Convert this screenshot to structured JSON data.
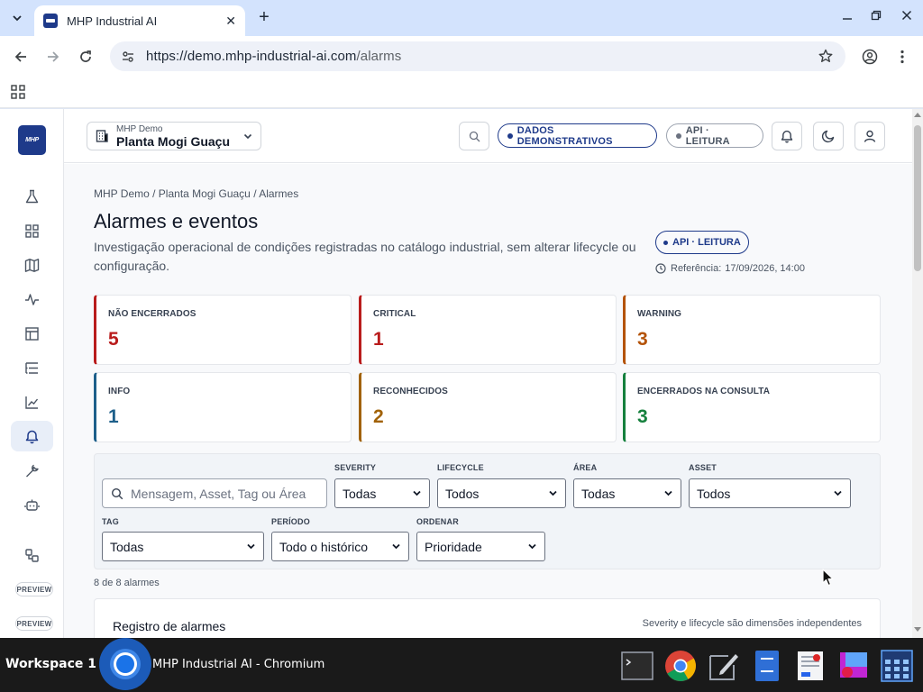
{
  "browser": {
    "tab_title": "MHP Industrial AI",
    "url_host": "https://demo.mhp-industrial-ai.com",
    "url_path": "/alarms",
    "close_glyph": "✕",
    "newtab_glyph": "+"
  },
  "topbar": {
    "org": "MHP Demo",
    "plant": "Planta Mogi Guaçu",
    "demo_pill": "DADOS DEMONSTRATIVOS",
    "api_pill": "API · LEITURA"
  },
  "sidebar": {
    "logo_text": "MHP",
    "items": [
      {
        "icon": "flask-icon"
      },
      {
        "icon": "grid-icon"
      },
      {
        "icon": "map-icon"
      },
      {
        "icon": "activity-icon"
      },
      {
        "icon": "layout-icon"
      },
      {
        "icon": "list-tree-icon"
      },
      {
        "icon": "chart-line-icon"
      },
      {
        "icon": "bell-icon",
        "active": true
      },
      {
        "icon": "wrench-icon"
      },
      {
        "icon": "bot-icon"
      },
      {
        "icon": "workflow-icon"
      }
    ],
    "preview_badges": [
      "PREVIEW",
      "PREVIEW"
    ]
  },
  "page": {
    "breadcrumb": "MHP Demo / Planta Mogi Guaçu / Alarmes",
    "title": "Alarmes e eventos",
    "description": "Investigação operacional de condições registradas no catálogo industrial, sem alterar lifecycle ou configuração.",
    "api_badge": "API · LEITURA",
    "ref_label": "Referência:",
    "ref_value": "17/09/2026, 14:00"
  },
  "kpis": [
    {
      "label": "NÃO ENCERRADOS",
      "value": "5",
      "color": "#b91c1c"
    },
    {
      "label": "CRITICAL",
      "value": "1",
      "color": "#b91c1c"
    },
    {
      "label": "WARNING",
      "value": "3",
      "color": "#b45309"
    },
    {
      "label": "INFO",
      "value": "1",
      "color": "#1d5f8a"
    },
    {
      "label": "RECONHECIDOS",
      "value": "2",
      "color": "#a16207"
    },
    {
      "label": "ENCERRADOS NA CONSULTA",
      "value": "3",
      "color": "#15803d"
    }
  ],
  "filters": {
    "search_placeholder": "Mensagem, Asset, Tag ou Área",
    "severity": {
      "label": "SEVERITY",
      "value": "Todas"
    },
    "lifecycle": {
      "label": "LIFECYCLE",
      "value": "Todos"
    },
    "area": {
      "label": "ÁREA",
      "value": "Todas"
    },
    "asset": {
      "label": "ASSET",
      "value": "Todos"
    },
    "tag": {
      "label": "TAG",
      "value": "Todas"
    },
    "periodo": {
      "label": "PERÍODO",
      "value": "Todo o histórico"
    },
    "ordenar": {
      "label": "ORDENAR",
      "value": "Prioridade"
    }
  },
  "results": {
    "count": "8 de 8 alarmes",
    "table_title": "Registro de alarmes",
    "table_note": "Severity e lifecycle são dimensões independentes"
  },
  "taskbar": {
    "workspace": "Workspace 1",
    "active_window": "MHP Industrial AI - Chromium"
  }
}
